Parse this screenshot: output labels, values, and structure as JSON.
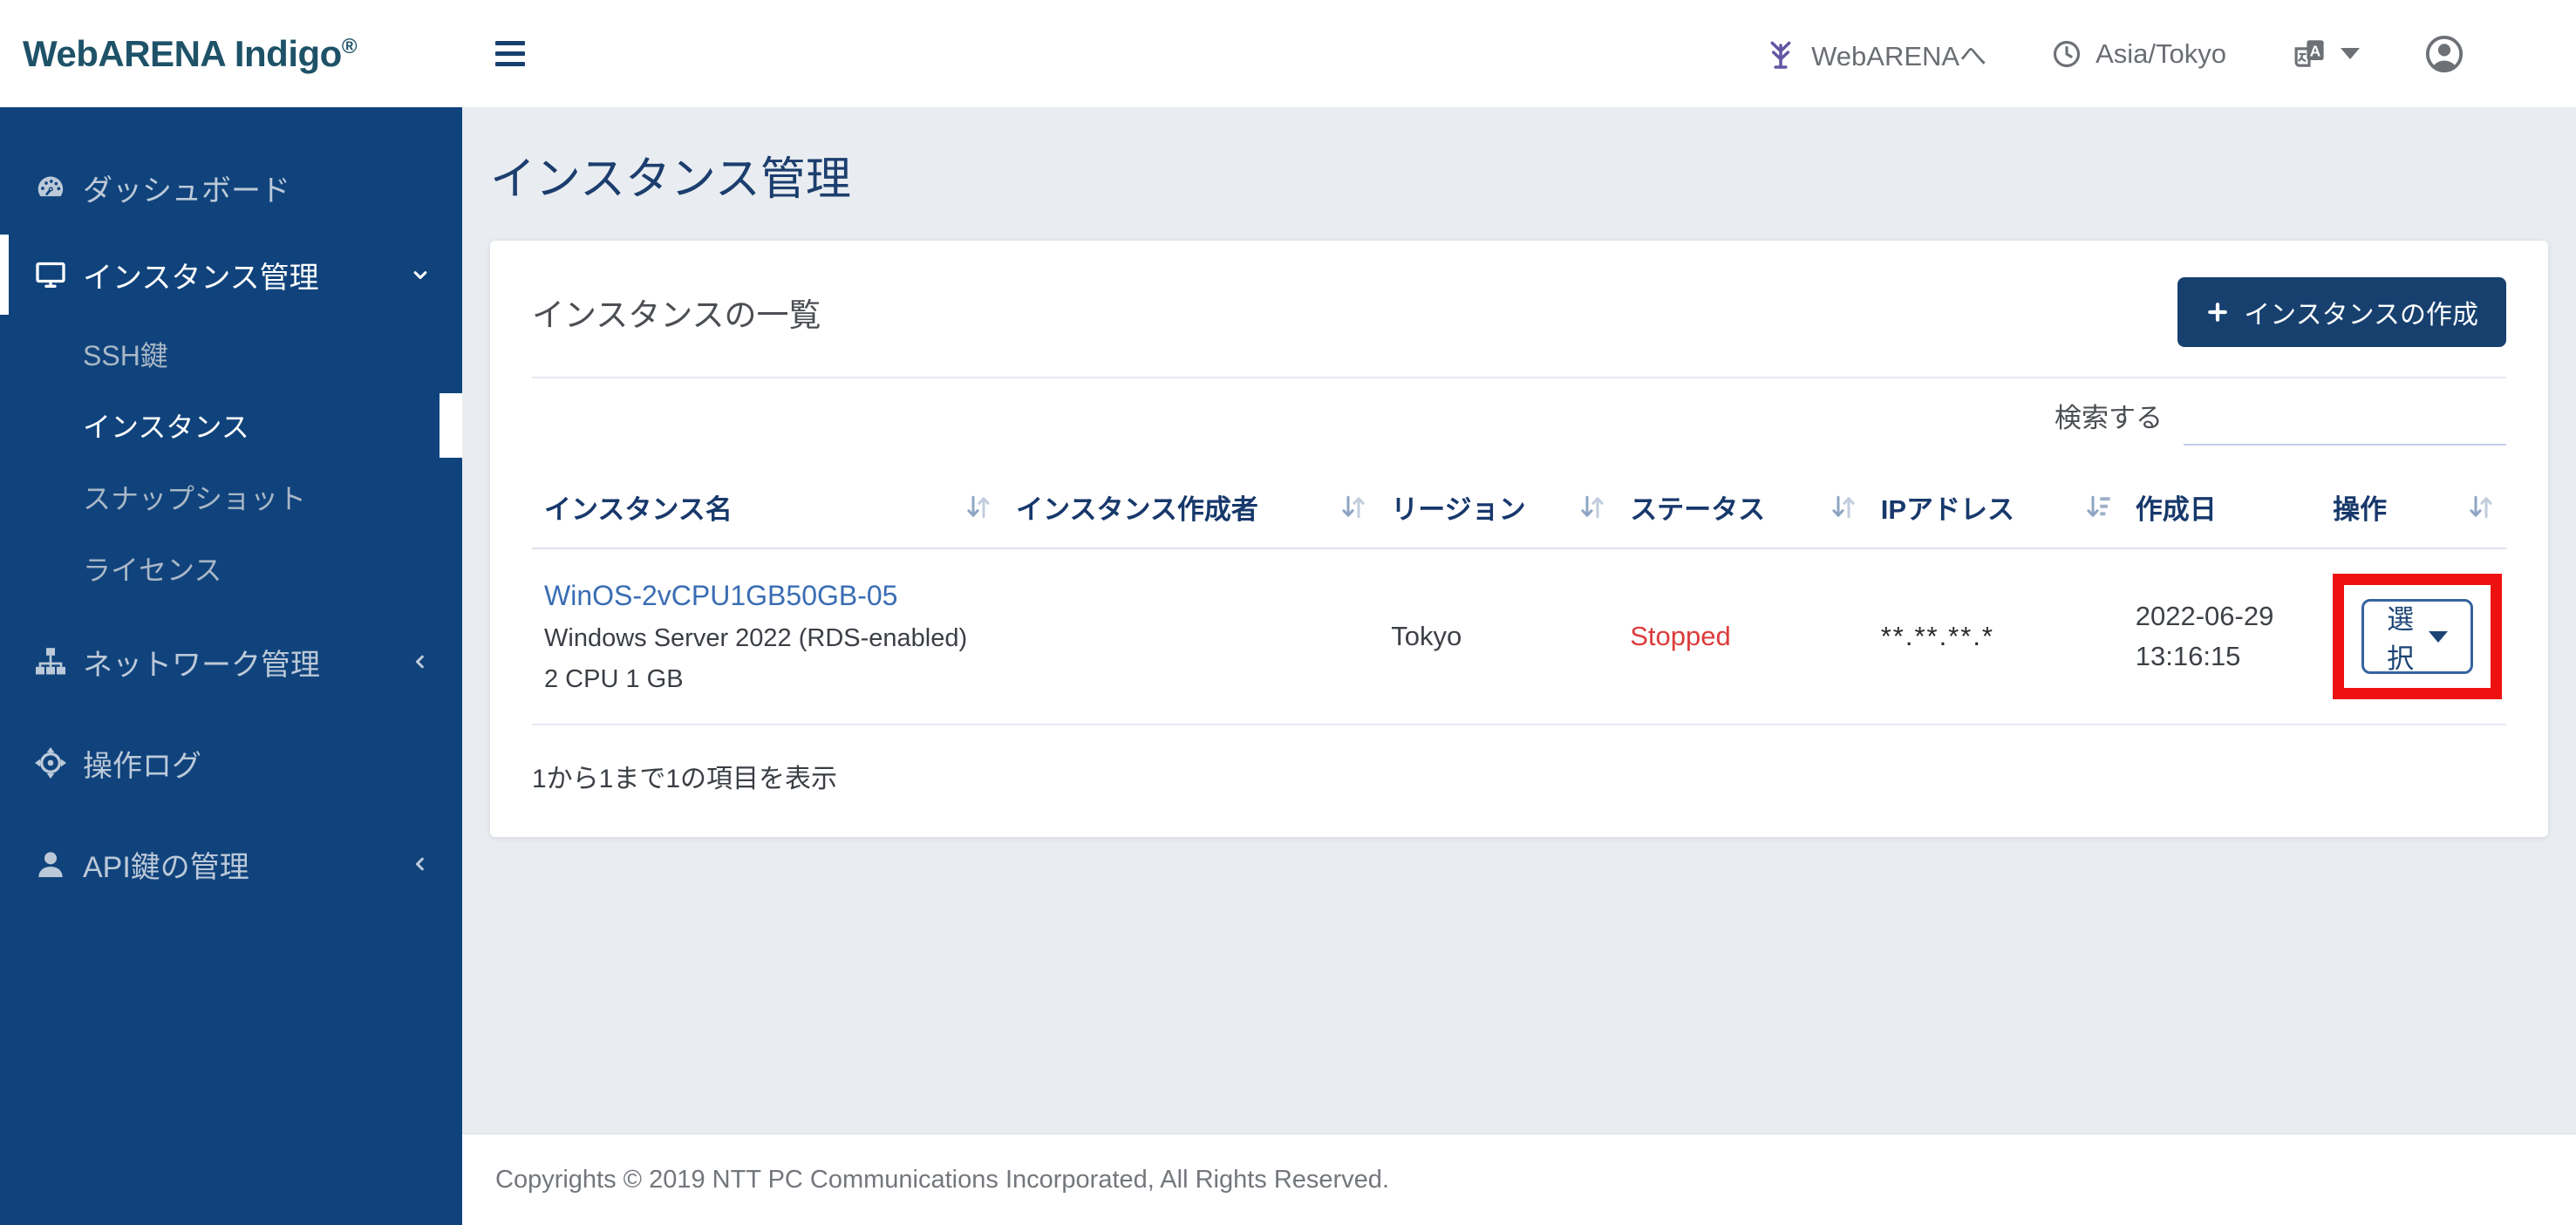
{
  "header": {
    "logo": "WebARENA Indigo",
    "logo_sup": "®",
    "webarena_link": "WebARENAへ",
    "timezone": "Asia/Tokyo"
  },
  "sidebar": {
    "items": [
      {
        "label": "ダッシュボード",
        "icon": "dashboard-icon",
        "active": false
      },
      {
        "label": "インスタンス管理",
        "icon": "monitor-icon",
        "active": true,
        "chevron": "down"
      },
      {
        "label": "SSH鍵",
        "sub": true,
        "active": false
      },
      {
        "label": "インスタンス",
        "sub": true,
        "active": true
      },
      {
        "label": "スナップショット",
        "sub": true,
        "active": false
      },
      {
        "label": "ライセンス",
        "sub": true,
        "active": false
      },
      {
        "label": "ネットワーク管理",
        "icon": "sitemap-icon",
        "active": false,
        "chevron": "left"
      },
      {
        "label": "操作ログ",
        "icon": "crosshair-icon",
        "active": false
      },
      {
        "label": "API鍵の管理",
        "icon": "user-icon",
        "active": false,
        "chevron": "left"
      }
    ]
  },
  "page": {
    "title": "インスタンス管理"
  },
  "card": {
    "title": "インスタンスの一覧",
    "create_button": "インスタンスの作成",
    "search_label": "検索する",
    "search_value": "",
    "summary": "1から1まで1の項目を表示"
  },
  "table": {
    "columns": [
      {
        "label": "インスタンス名",
        "sort": "unsorted"
      },
      {
        "label": "インスタンス作成者",
        "sort": "unsorted"
      },
      {
        "label": "リージョン",
        "sort": "unsorted"
      },
      {
        "label": "ステータス",
        "sort": "unsorted"
      },
      {
        "label": "IPアドレス",
        "sort": "sorted-desc"
      },
      {
        "label": "作成日",
        "sort": "none"
      },
      {
        "label": "操作",
        "sort": "unsorted"
      }
    ],
    "rows": [
      {
        "name": "WinOS-2vCPU1GB50GB-05",
        "os": "Windows Server 2022 (RDS-enabled)",
        "spec": "2 CPU 1 GB",
        "creator": "",
        "region": "Tokyo",
        "status": "Stopped",
        "ip_masked": "**.**.**.*",
        "created_date": "2022-06-29",
        "created_time": "13:16:15",
        "action_label": "選択"
      }
    ]
  },
  "footer": {
    "copyright": "Copyrights © 2019 NTT PC Communications Incorporated, All Rights Reserved."
  },
  "colors": {
    "sidebar": "#10437C",
    "primary_button": "#17406F",
    "link": "#3A6DB3",
    "status_stopped": "#DD3B3B",
    "highlight_box": "#EE1111",
    "page_title": "#1C3E6E"
  }
}
